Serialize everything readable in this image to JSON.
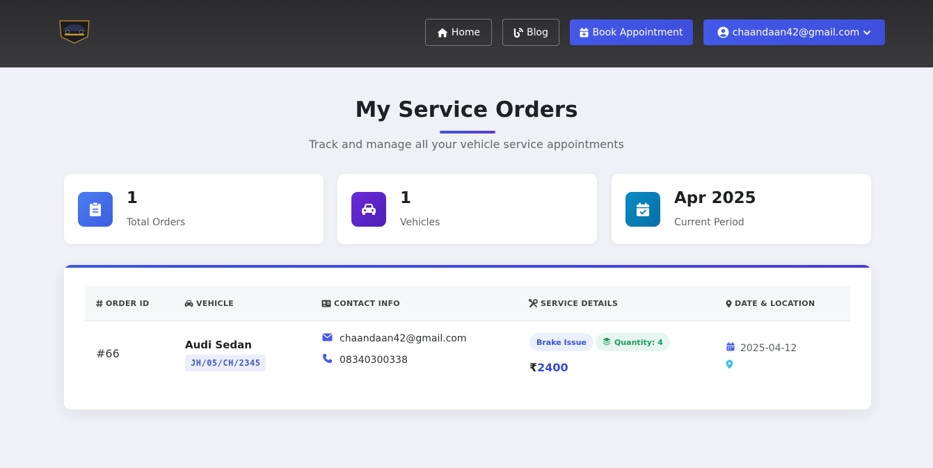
{
  "nav": {
    "logo_icon": "car-logo",
    "home_label": "Home",
    "blog_label": "Blog",
    "book_label": "Book Appointment",
    "user_label": "chaandaan42@gmail.com"
  },
  "page": {
    "title": "My Service Orders",
    "subtitle": "Track and manage all your vehicle service appointments"
  },
  "stats": [
    {
      "value": "1",
      "label": "Total Orders",
      "icon": "clipboard-icon"
    },
    {
      "value": "1",
      "label": "Vehicles",
      "icon": "car-icon"
    },
    {
      "value": "Apr 2025",
      "label": "Current Period",
      "icon": "calendar-check-icon"
    }
  ],
  "table": {
    "headers": {
      "order": "ORDER ID",
      "vehicle": "VEHICLE",
      "contact": "CONTACT INFO",
      "service": "SERVICE DETAILS",
      "date": "DATE & LOCATION"
    },
    "rows": [
      {
        "order_id": "#66",
        "vehicle_name": "Audi Sedan",
        "plate": "JH/05/CH/2345",
        "email": "chaandaan42@gmail.com",
        "phone": "08340300338",
        "issue": "Brake Issue",
        "quantity": "Quantity: 4",
        "currency": "₹",
        "price": "2400",
        "date": "2025-04-12"
      }
    ]
  },
  "colors": {
    "accent": "#4359e8",
    "background": "#eff1f6",
    "header": "#2f2f32"
  }
}
